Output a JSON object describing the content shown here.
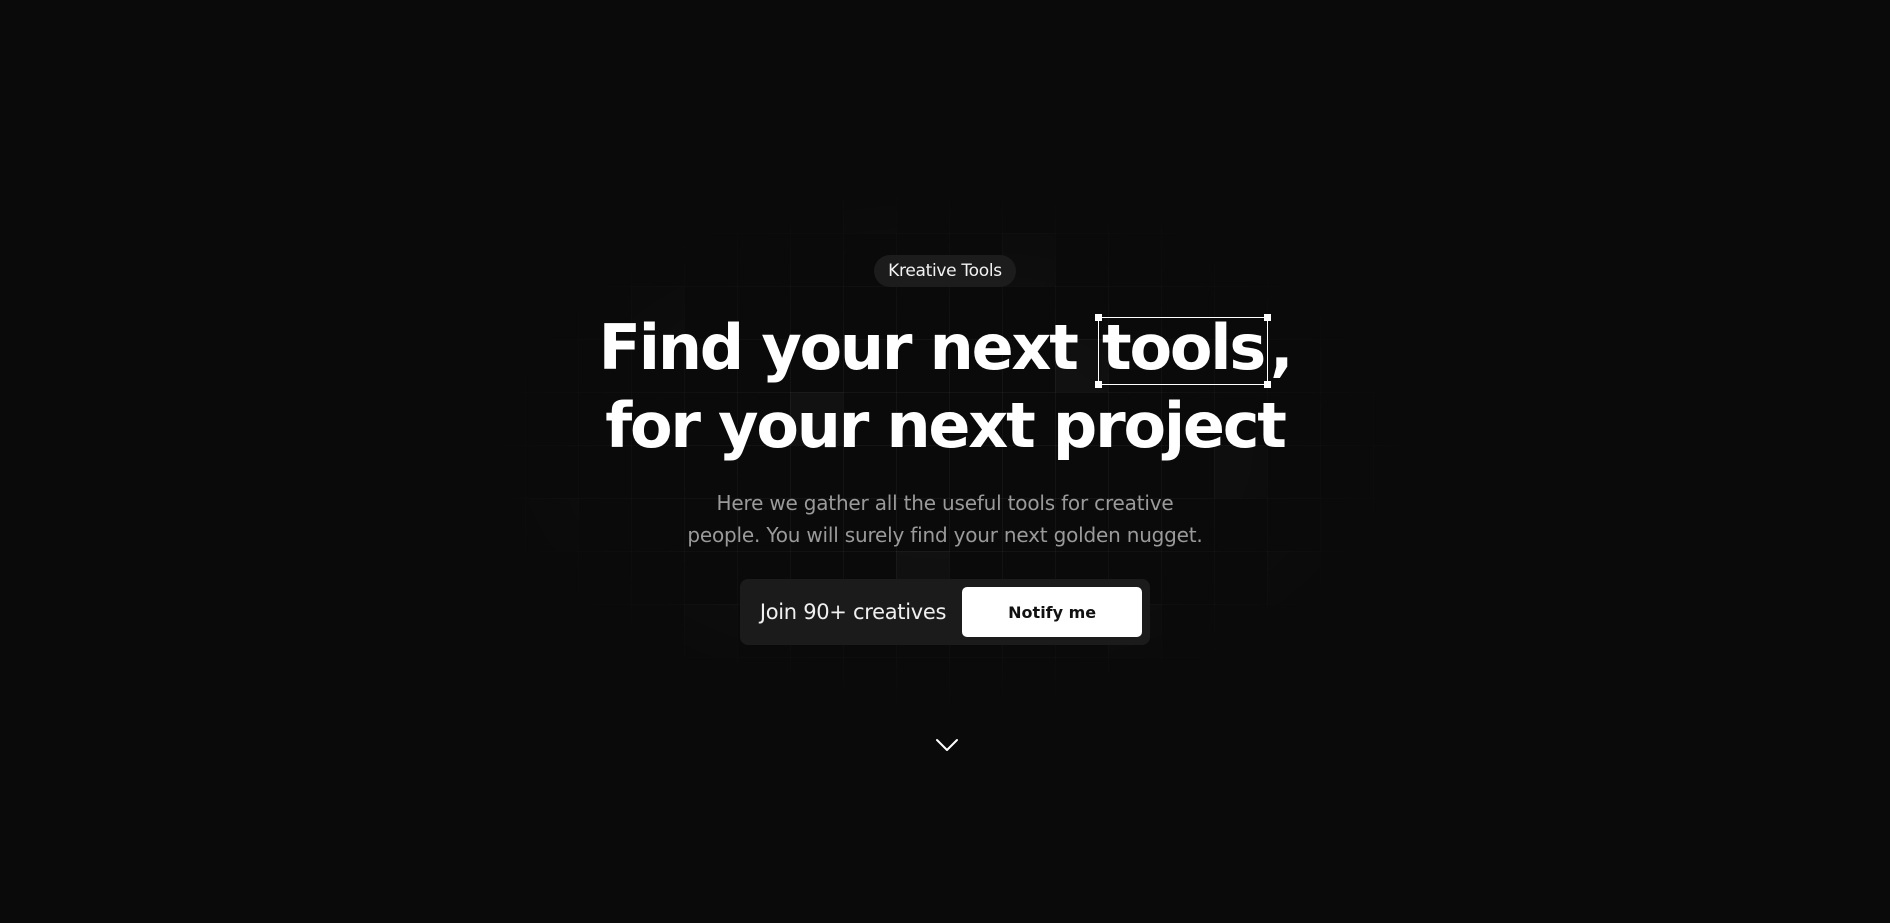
{
  "hero": {
    "badge": "Kreative Tools",
    "title_line1_before": "Find your next",
    "title_highlight": "tools",
    "title_line1_after": ",",
    "title_line2": "for your next project",
    "subtitle_line1": "Here we gather all the useful tools for creative",
    "subtitle_line2": "people. You will surely find your next golden nugget."
  },
  "cta": {
    "label": "Join 90+ creatives",
    "button": "Notify me"
  },
  "icons": {
    "scroll": "chevron-down-icon"
  },
  "colors": {
    "background": "#0a0a0a",
    "text": "#ffffff",
    "muted": "#9a9a9a",
    "surface": "#1b1b1b",
    "button_bg": "#ffffff",
    "button_text": "#111111"
  }
}
